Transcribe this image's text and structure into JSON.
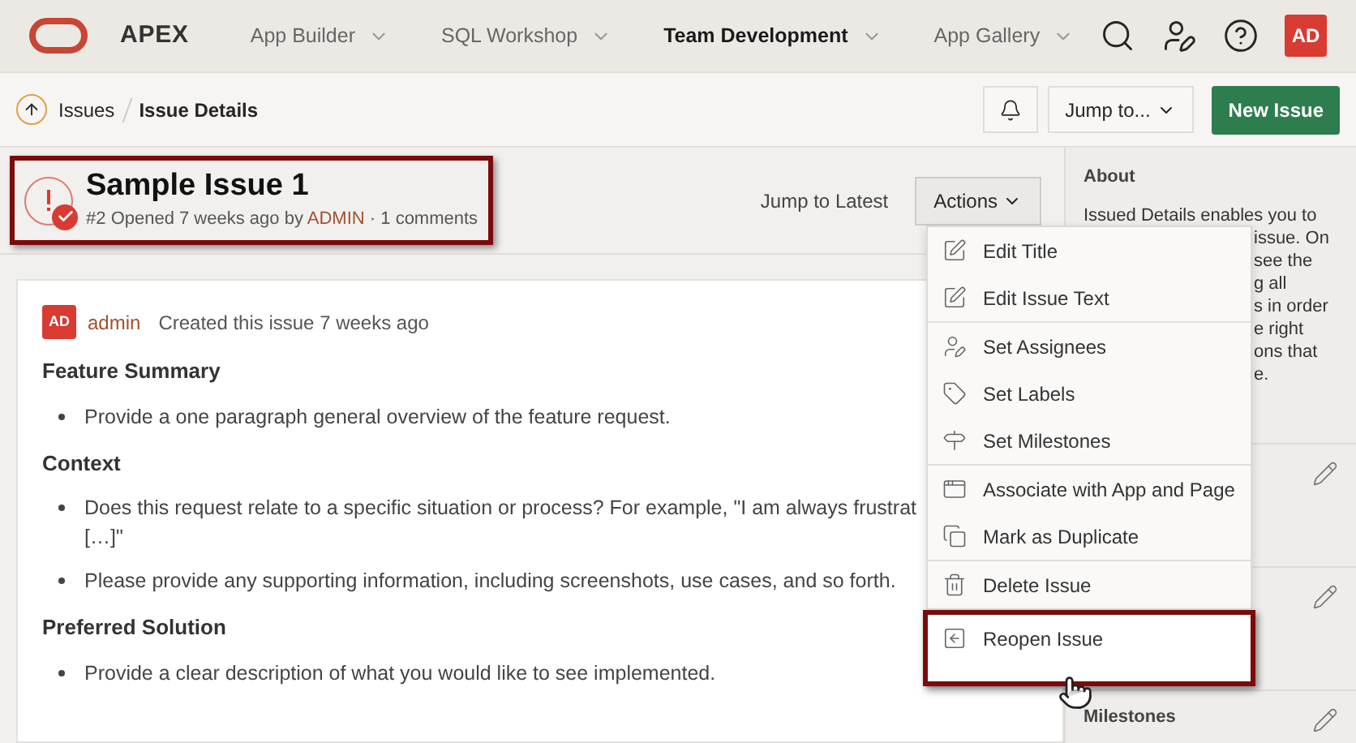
{
  "header": {
    "brand": "APEX",
    "nav": [
      {
        "label": "App Builder",
        "selected": false
      },
      {
        "label": "SQL Workshop",
        "selected": false
      },
      {
        "label": "Team Development",
        "selected": true
      },
      {
        "label": "App Gallery",
        "selected": false
      }
    ],
    "avatar": "AD"
  },
  "breadcrumb": {
    "items": [
      "Issues",
      "Issue Details"
    ],
    "jump": "Jump to...",
    "new_button": "New Issue"
  },
  "issue": {
    "title": "Sample Issue 1",
    "number": "#2",
    "opened": "Opened 7 weeks ago by",
    "author": "ADMIN",
    "comments": "· 1 comments",
    "callout": true
  },
  "toolbar": {
    "jump_latest": "Jump to Latest",
    "actions": "Actions"
  },
  "post": {
    "avatar": "AD",
    "user": "admin",
    "meta": "Created this issue 7 weeks ago",
    "sections": [
      {
        "heading": "Feature Summary",
        "bullets": [
          [
            "Provide a one paragraph general overview of the feature request."
          ]
        ]
      },
      {
        "heading": "Context",
        "bullets": [
          [
            "Does this request relate to a specific situation or process? For example, \"I am always frustrat",
            "[…]\""
          ],
          [
            "Please provide any supporting information, including screenshots, use cases, and so forth."
          ]
        ]
      },
      {
        "heading": "Preferred Solution",
        "bullets": [
          [
            "Provide a clear description of what you would like to see implemented."
          ]
        ]
      }
    ]
  },
  "menu": {
    "groups": [
      [
        {
          "kind": "edit",
          "label": "Edit Title",
          "callout": false
        },
        {
          "kind": "edit",
          "label": "Edit Issue Text",
          "callout": false
        }
      ],
      [
        {
          "kind": "user",
          "label": "Set Assignees",
          "callout": false
        },
        {
          "kind": "tag",
          "label": "Set Labels",
          "callout": false
        },
        {
          "kind": "milestone",
          "label": "Set Milestones",
          "callout": false
        }
      ],
      [
        {
          "kind": "associate",
          "label": "Associate with App and Page",
          "callout": false
        },
        {
          "kind": "duplicate",
          "label": "Mark as Duplicate",
          "callout": false
        }
      ],
      [
        {
          "kind": "delete",
          "label": "Delete Issue",
          "callout": false
        }
      ],
      [
        {
          "kind": "reopen",
          "label": "Reopen Issue",
          "callout": true
        }
      ]
    ]
  },
  "sidebar": {
    "about": {
      "title": "About",
      "lines": [
        "Issued Details enables you to",
        "issue. On",
        "see the",
        "g all",
        "s in order",
        "e right",
        "ons that",
        "e."
      ]
    },
    "sections": [
      {
        "editable": true
      },
      {
        "editable": true
      },
      {
        "title": "Milestones",
        "editable": true
      }
    ]
  }
}
